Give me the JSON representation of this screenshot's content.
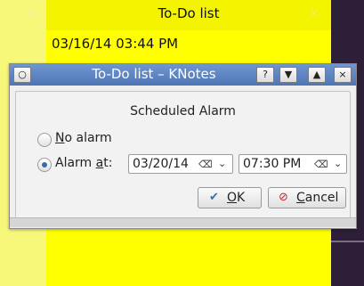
{
  "knote": {
    "title": "To-Do list",
    "close_glyph": "×",
    "date_text": "03/16/14 03:44 PM"
  },
  "dialog": {
    "title": "To-Do list – KNotes",
    "titlebar_buttons": {
      "menu": "○",
      "help": "?",
      "shade_down": "▼",
      "shade_up": "▲",
      "close": "×"
    },
    "group_title": "Scheduled Alarm",
    "options": {
      "no_alarm": {
        "accel": "N",
        "rest": "o alarm",
        "checked": false
      },
      "alarm_at": {
        "pre": "Alarm ",
        "accel": "a",
        "rest": "t:",
        "checked": true
      }
    },
    "date_field": {
      "value": "03/20/14"
    },
    "time_field": {
      "value": "07:30 PM"
    },
    "clear_glyph": "⌫",
    "dropdown_glyph": "⌄",
    "buttons": {
      "ok": {
        "icon": "✔",
        "accel": "O",
        "rest": "K"
      },
      "cancel": {
        "icon": "⊘",
        "accel": "C",
        "rest": "ancel"
      }
    }
  }
}
